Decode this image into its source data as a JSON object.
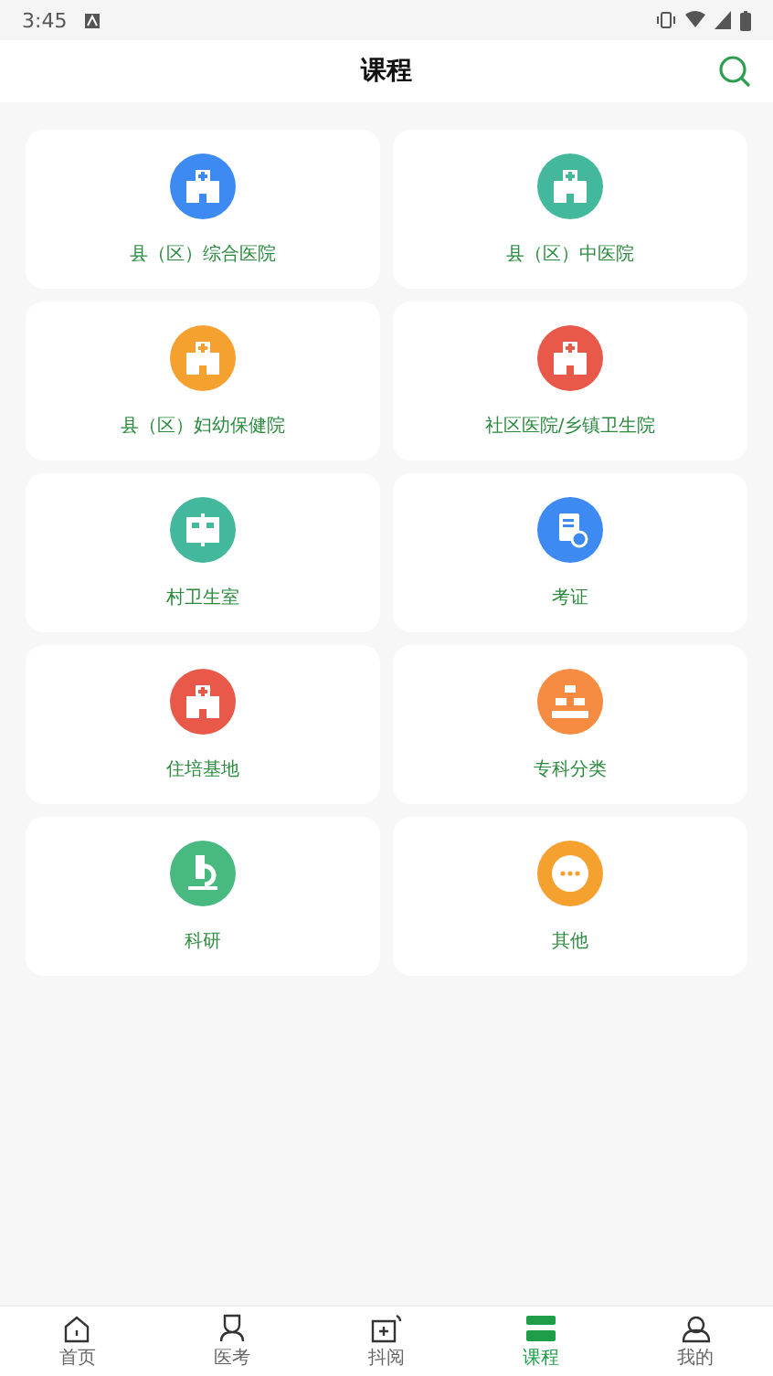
{
  "status_bar": {
    "time": "3:45"
  },
  "header": {
    "title": "课程"
  },
  "categories": [
    {
      "label": "县（区）综合医院",
      "color": "#3d8bf2"
    },
    {
      "label": "县（区）中医院",
      "color": "#43b89c"
    },
    {
      "label": "县（区）妇幼保健院",
      "color": "#f4a12f"
    },
    {
      "label": "社区医院/乡镇卫生院",
      "color": "#e9594a"
    },
    {
      "label": "村卫生室",
      "color": "#43b89c"
    },
    {
      "label": "考证",
      "color": "#3d8bf2"
    },
    {
      "label": "住培基地",
      "color": "#e9594a"
    },
    {
      "label": "专科分类",
      "color": "#f58c42"
    },
    {
      "label": "科研",
      "color": "#48b97f"
    },
    {
      "label": "其他",
      "color": "#f4a12f"
    }
  ],
  "bottom_nav": [
    {
      "label": "首页",
      "selected": false
    },
    {
      "label": "医考",
      "selected": false
    },
    {
      "label": "抖阅",
      "selected": false
    },
    {
      "label": "课程",
      "selected": true
    },
    {
      "label": "我的",
      "selected": false
    }
  ]
}
